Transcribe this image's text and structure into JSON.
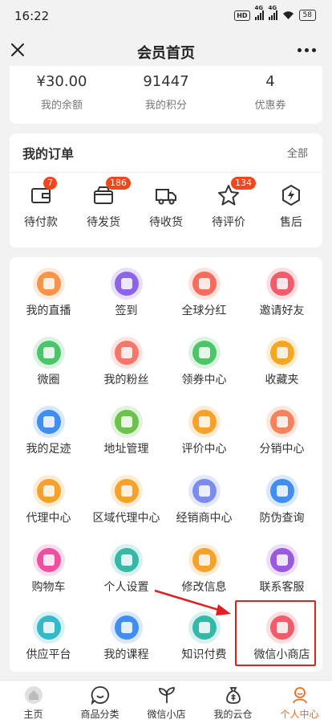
{
  "status_bar": {
    "time": "16:22",
    "hd": "HD",
    "network": "4G",
    "battery": "58"
  },
  "nav": {
    "title": "会员首页"
  },
  "stats": [
    {
      "value": "¥30.00",
      "label": "我的余额"
    },
    {
      "value": "91447",
      "label": "我的积分"
    },
    {
      "value": "4",
      "label": "优惠券"
    }
  ],
  "orders": {
    "title": "我的订单",
    "all": "全部",
    "items": [
      {
        "label": "待付款",
        "badge": "7",
        "icon": "wallet-icon"
      },
      {
        "label": "待发货",
        "badge": "186",
        "icon": "package-box-icon"
      },
      {
        "label": "待收货",
        "badge": "",
        "icon": "delivery-truck-icon"
      },
      {
        "label": "待评价",
        "badge": "134",
        "icon": "star-icon"
      },
      {
        "label": "售后",
        "badge": "",
        "icon": "lightning-hexagon-icon"
      }
    ]
  },
  "menu": [
    {
      "label": "我的直播",
      "icon": "live-tv-icon",
      "color": "#f7944a"
    },
    {
      "label": "签到",
      "icon": "calendar-icon",
      "color": "#8b64e8"
    },
    {
      "label": "全球分红",
      "icon": "dividend-icon",
      "color": "#f36c5c"
    },
    {
      "label": "邀请好友",
      "icon": "qr-code-icon",
      "color": "#f25c6a"
    },
    {
      "label": "微圈",
      "icon": "chat-bubble-icon",
      "color": "#4cc56a"
    },
    {
      "label": "我的粉丝",
      "icon": "fans-icon",
      "color": "#f5776a"
    },
    {
      "label": "领券中心",
      "icon": "coupon-icon",
      "color": "#4cc56a"
    },
    {
      "label": "收藏夹",
      "icon": "star-icon",
      "color": "#f6a623"
    },
    {
      "label": "我的足迹",
      "icon": "footprint-icon",
      "color": "#3f8ef0"
    },
    {
      "label": "地址管理",
      "icon": "location-pin-icon",
      "color": "#6dc24b"
    },
    {
      "label": "评价中心",
      "icon": "comment-icon",
      "color": "#f5a12a"
    },
    {
      "label": "分销中心",
      "icon": "money-bag-icon",
      "color": "#f5825a"
    },
    {
      "label": "代理中心",
      "icon": "agent-icon",
      "color": "#f5a12a"
    },
    {
      "label": "区域代理中心",
      "icon": "regional-agent-icon",
      "color": "#f5a12a"
    },
    {
      "label": "经销商中心",
      "icon": "dealer-icon",
      "color": "#7a8cf0"
    },
    {
      "label": "防伪查询",
      "icon": "shield-icon",
      "color": "#3f8ef0"
    },
    {
      "label": "购物车",
      "icon": "shopping-cart-icon",
      "color": "#ef4fa0"
    },
    {
      "label": "个人设置",
      "icon": "gear-icon",
      "color": "#35b8a8"
    },
    {
      "label": "修改信息",
      "icon": "edit-profile-icon",
      "color": "#f5a12a"
    },
    {
      "label": "联系客服",
      "icon": "phone-icon",
      "color": "#9b59e0"
    },
    {
      "label": "供应平台",
      "icon": "supply-icon",
      "color": "#35b8c8"
    },
    {
      "label": "我的课程",
      "icon": "course-icon",
      "color": "#3f8ef0"
    },
    {
      "label": "知识付费",
      "icon": "graduation-cap-icon",
      "color": "#35b8a8"
    },
    {
      "label": "微信小商店",
      "icon": "wechat-store-icon",
      "color": "#f25c6a"
    }
  ],
  "tabs": [
    {
      "label": "主页",
      "icon": "home-icon",
      "active": false
    },
    {
      "label": "商品分类",
      "icon": "smile-chat-icon",
      "active": false
    },
    {
      "label": "微信小店",
      "icon": "sprout-icon",
      "active": false
    },
    {
      "label": "我的云仓",
      "icon": "money-bag-icon",
      "active": false
    },
    {
      "label": "个人中心",
      "icon": "user-profile-icon",
      "active": true
    }
  ]
}
